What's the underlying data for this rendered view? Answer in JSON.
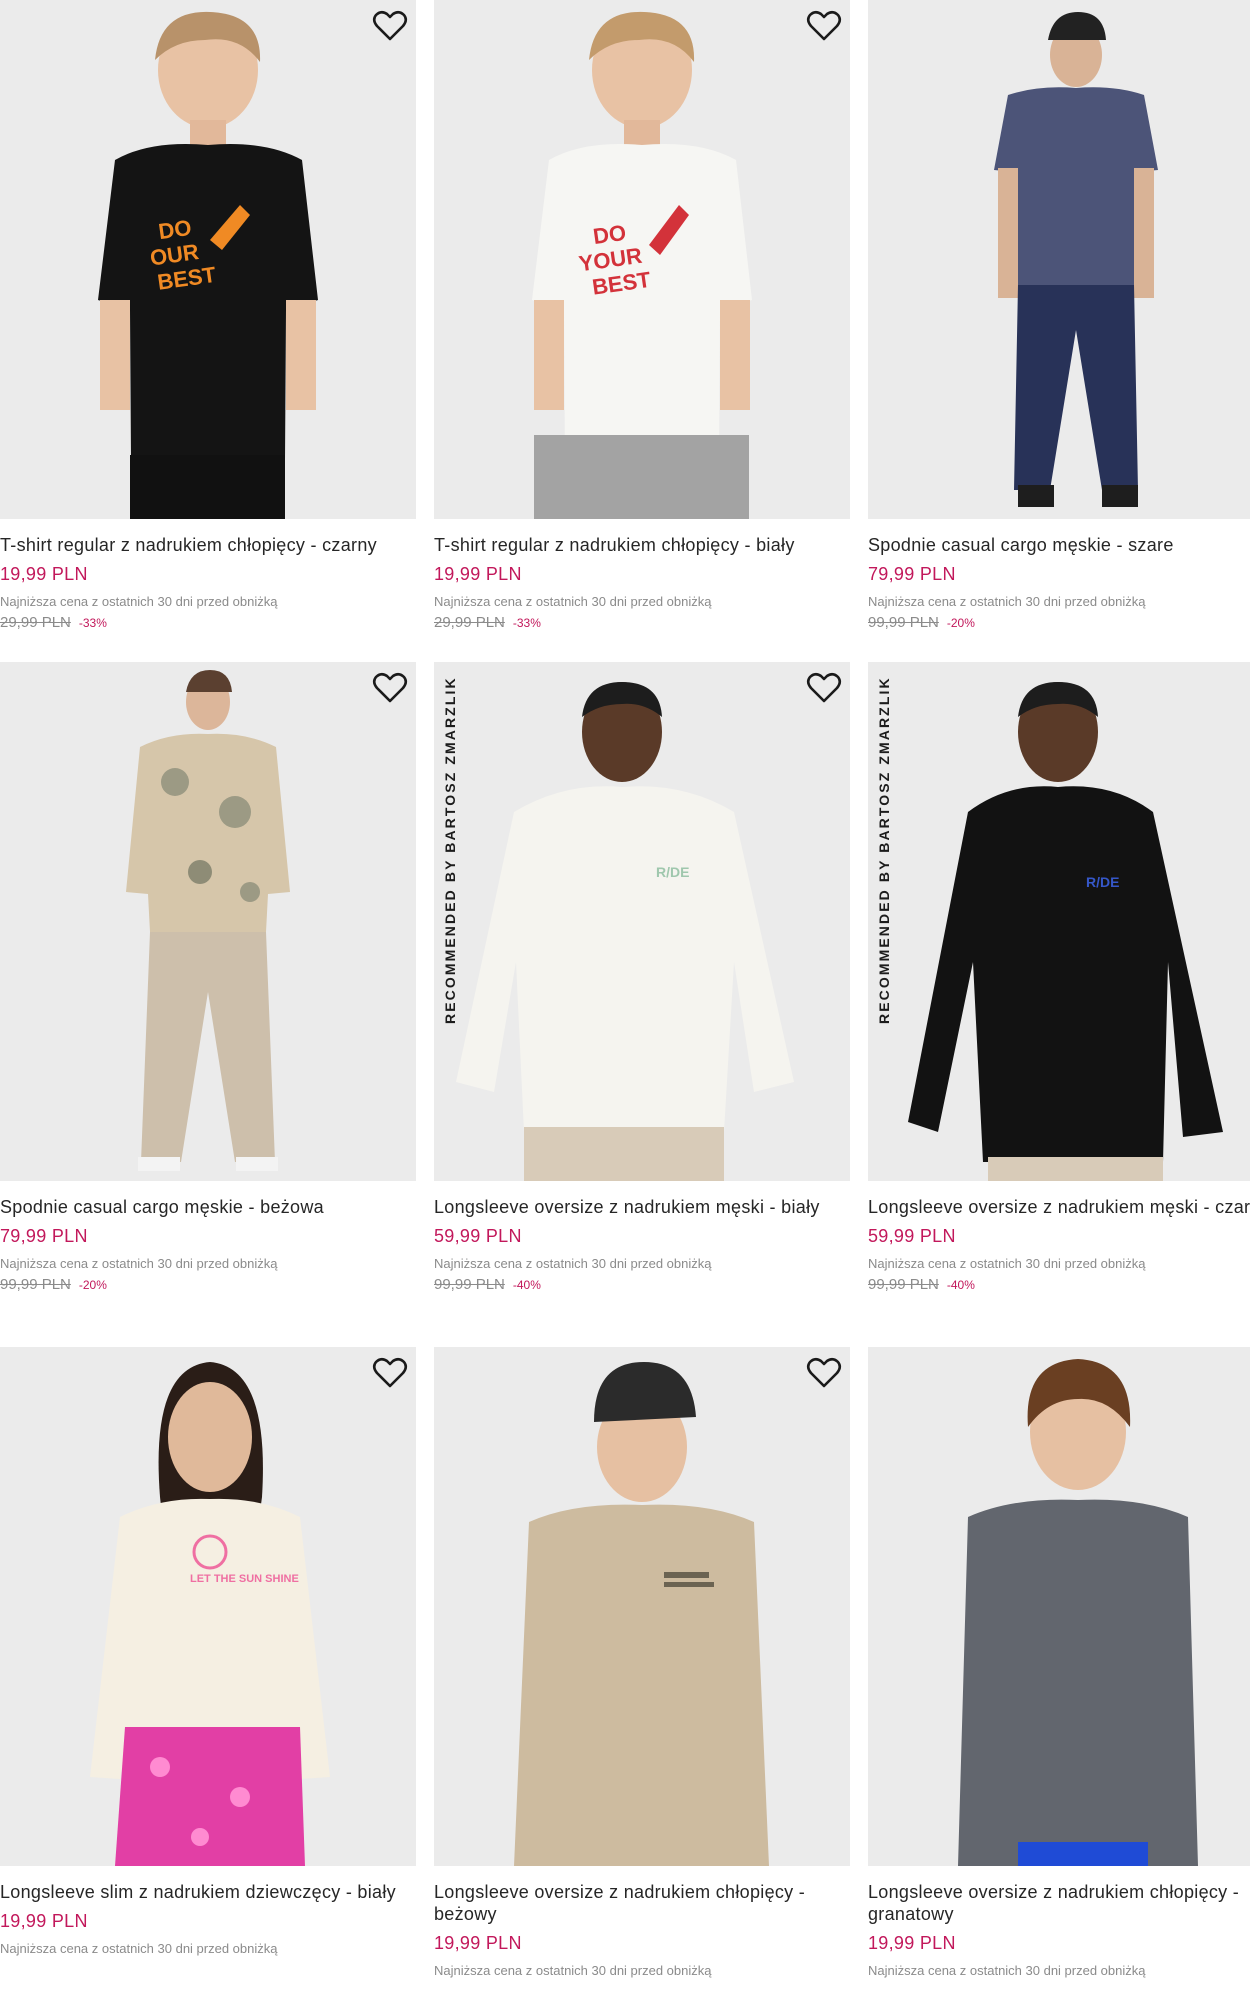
{
  "colors": {
    "background": "#ffffff",
    "photo_bg": "#e9e9e9",
    "price": "#c2185b",
    "note": "#8b8b8b",
    "title": "#262626"
  },
  "icons": {
    "favorite": "heart-outline-icon"
  },
  "products": [
    {
      "title": "T-shirt regular z nadrukiem chłopięcy - czarny",
      "price": "19,99 PLN",
      "lowest_note": "Najniższa cena z ostatnich 30 dni przed obniżką",
      "old_price": "29,99 PLN",
      "discount": "-33%",
      "badge": ""
    },
    {
      "title": "T-shirt regular z nadrukiem chłopięcy - biały",
      "price": "19,99 PLN",
      "lowest_note": "Najniższa cena z ostatnich 30 dni przed obniżką",
      "old_price": "29,99 PLN",
      "discount": "-33%",
      "badge": ""
    },
    {
      "title": "Spodnie casual cargo męskie - szare",
      "price": "79,99 PLN",
      "lowest_note": "Najniższa cena z ostatnich 30 dni przed obniżką",
      "old_price": "99,99 PLN",
      "discount": "-20%",
      "badge": ""
    },
    {
      "title": "Spodnie casual cargo męskie - beżowa",
      "price": "79,99 PLN",
      "lowest_note": "Najniższa cena z ostatnich 30 dni przed obniżką",
      "old_price": "99,99 PLN",
      "discount": "-20%",
      "badge": ""
    },
    {
      "title": "Longsleeve oversize z nadrukiem męski - biały",
      "price": "59,99 PLN",
      "lowest_note": "Najniższa cena z ostatnich 30 dni przed obniżką",
      "old_price": "99,99 PLN",
      "discount": "-40%",
      "badge": "RECOMMENDED BY BARTOSZ ZMARZLIK"
    },
    {
      "title": "Longsleeve oversize z nadrukiem męski - czarny",
      "price": "59,99 PLN",
      "lowest_note": "Najniższa cena z ostatnich 30 dni przed obniżką",
      "old_price": "99,99 PLN",
      "discount": "-40%",
      "badge": "RECOMMENDED BY BARTOSZ ZMARZLIK"
    },
    {
      "title": "Longsleeve slim z nadrukiem dziewczęcy - biały",
      "price": "19,99 PLN",
      "lowest_note": "Najniższa cena z ostatnich 30 dni przed obniżką",
      "old_price": "",
      "discount": "",
      "badge": ""
    },
    {
      "title": "Longsleeve oversize z nadrukiem chłopięcy - beżowy",
      "price": "19,99 PLN",
      "lowest_note": "Najniższa cena z ostatnich 30 dni przed obniżką",
      "old_price": "",
      "discount": "",
      "badge": ""
    },
    {
      "title": "Longsleeve oversize z nadrukiem chłopięcy - granatowy",
      "price": "19,99 PLN",
      "lowest_note": "Najniższa cena z ostatnich 30 dni przed obniżką",
      "old_price": "",
      "discount": "",
      "badge": ""
    }
  ]
}
